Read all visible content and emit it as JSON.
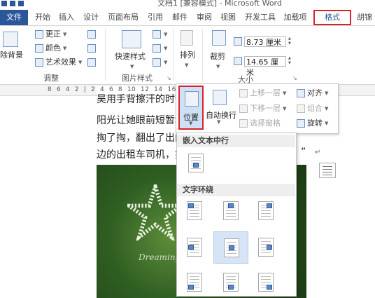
{
  "window": {
    "title": "文档1 [兼容模式] - Microsoft Word"
  },
  "tabs": {
    "file": "文件",
    "items": [
      "开始",
      "插入",
      "设计",
      "页面布局",
      "引用",
      "邮件",
      "审阅",
      "视图",
      "开发工具",
      "加载项"
    ],
    "format": "格式",
    "user": "胡锦"
  },
  "ribbon": {
    "adjust": {
      "remove_bg": "除背景",
      "corrections": "更正",
      "color": "颜色",
      "artistic": "艺术效果",
      "label": "调整"
    },
    "picture_styles": {
      "quick_styles": "快速样式",
      "label": "图片样式"
    },
    "arrange": {
      "label": "排列"
    },
    "size": {
      "crop": "裁剪",
      "height": "8.73 厘米",
      "width": "14.65 厘米",
      "label": "大小"
    }
  },
  "ruler": {
    "text": "8  6  4  2  |  2  4  6  8  10  12  14  16  18  20  22  24  26  28  30  32  34"
  },
  "document": {
    "lines": [
      "吴用手背擦汗的时候",
      "阳光让她眼前短暂地",
      "掏了掏，翻出了出门",
      "边的出租车司机，笑"
    ],
    "closing_quote": "”",
    "para_mark": "↵",
    "watermark": "Dreamingg"
  },
  "arrange_panel": {
    "position": "位置",
    "auto_wrap": "自动换行",
    "bring_forward": "上移一层",
    "send_backward": "下移一层",
    "selection_pane": "选择窗格",
    "align": "对齐",
    "group": "组合",
    "rotate": "旋转"
  },
  "position_menu": {
    "inline_header": "嵌入文本中行",
    "wrap_header": "文字环绕"
  },
  "colors": {
    "accent": "#2b579a",
    "highlight": "#d9232a"
  }
}
